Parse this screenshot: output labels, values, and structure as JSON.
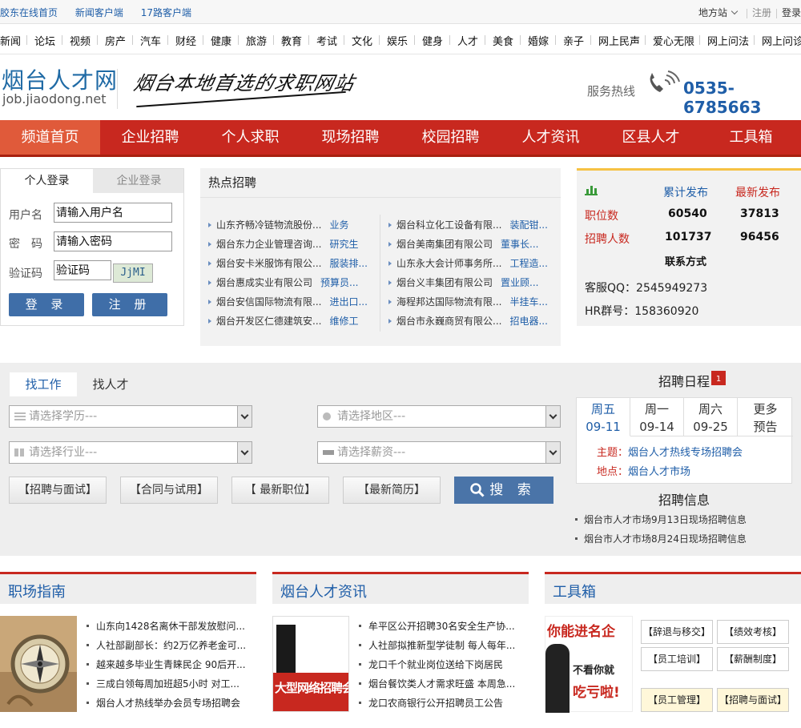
{
  "topbar": {
    "links": [
      "胶东在线首页",
      "新闻客户端",
      "17路客户端"
    ],
    "regional": "地方站",
    "register": "注册",
    "login": "登录"
  },
  "channels": [
    "新闻",
    "论坛",
    "视频",
    "房产",
    "汽车",
    "财经",
    "健康",
    "旅游",
    "教育",
    "考试",
    "文化",
    "娱乐",
    "健身",
    "人才",
    "美食",
    "婚嫁",
    "亲子",
    "网上民声",
    "爱心无限",
    "网上问法",
    "网上问诊"
  ],
  "header": {
    "logo_cn": "烟台人才网",
    "logo_en": "job.jiaodong.net",
    "slogan": "烟台本地首选的求职网站",
    "hotline_label": "服务热线",
    "hotline_number": "0535-6785663"
  },
  "mainnav": [
    "频道首页",
    "企业招聘",
    "个人求职",
    "现场招聘",
    "校园招聘",
    "人才资讯",
    "区县人才",
    "工具箱"
  ],
  "login": {
    "tab_personal": "个人登录",
    "tab_company": "企业登录",
    "username_label": "用户名",
    "username_value": "请输入用户名",
    "password_label": "密　码",
    "password_value": "请输入密码",
    "captcha_label": "验证码",
    "captcha_value": "验证码",
    "captcha_image": "JjMI",
    "login_btn": "登 录",
    "register_btn": "注 册"
  },
  "hot": {
    "title": "热点招聘",
    "left": [
      {
        "company": "山东齐畅冷链物流股份...",
        "job": "业务"
      },
      {
        "company": "烟台东力企业管理咨询...",
        "job": "研究生"
      },
      {
        "company": "烟台安卡米服饰有限公...",
        "job": "服装排..."
      },
      {
        "company": "烟台惠成实业有限公司",
        "job": "预算员..."
      },
      {
        "company": "烟台安信国际物流有限...",
        "job": "进出口..."
      },
      {
        "company": "烟台开发区仁德建筑安...",
        "job": "维修工"
      }
    ],
    "right": [
      {
        "company": "烟台科立化工设备有限...",
        "job": "装配钳..."
      },
      {
        "company": "烟台美南集团有限公司",
        "job": "董事长..."
      },
      {
        "company": "山东永大会计师事务所...",
        "job": "工程造..."
      },
      {
        "company": "烟台义丰集团有限公司",
        "job": "置业顾..."
      },
      {
        "company": "海程邦达国际物流有限...",
        "job": "半挂车..."
      },
      {
        "company": "烟台市永巍商贸有限公...",
        "job": "招电器..."
      }
    ]
  },
  "stats": {
    "col1": "累计发布",
    "col2": "最新发布",
    "row1_label": "职位数",
    "row1_total": "60540",
    "row1_new": "37813",
    "row2_label": "招聘人数",
    "row2_total": "101737",
    "row2_new": "96456",
    "contact_title": "联系方式",
    "qq": "客服QQ：2545949273",
    "hr_group": "HR群号：158360920"
  },
  "search": {
    "tab_find_job": "找工作",
    "tab_find_talent": "找人才",
    "education": "请选择学历---",
    "region": "请选择地区---",
    "industry": "请选择行业---",
    "salary": "请选择薪资---",
    "quick": [
      "【招聘与面试】",
      "【合同与试用】",
      "【 最新职位】",
      "【最新简历】"
    ],
    "search_btn": "搜 索"
  },
  "calendar": {
    "title": "招聘日程",
    "icon_num": "1",
    "days": [
      {
        "week": "周五",
        "date": "09-11"
      },
      {
        "week": "周一",
        "date": "09-14"
      },
      {
        "week": "周六",
        "date": "09-25"
      },
      {
        "week": "更多",
        "date": "预告"
      }
    ],
    "theme_label": "主题：",
    "theme_value": "烟台人才热线专场招聘会",
    "place_label": "地点：",
    "place_value": "烟台人才市场"
  },
  "info": {
    "title": "招聘信息",
    "items": [
      "烟台市人才市场9月13日现场招聘信息",
      "烟台市人才市场8月24日现场招聘信息"
    ]
  },
  "guide": {
    "title": "职场指南",
    "items": [
      "山东向1428名离休干部发放慰问...",
      "人社部副部长：约2万亿养老金可...",
      "越来越多毕业生青睐民企  90后开...",
      "三成白领每周加班超5小时  对工...",
      "烟台人才热线举办会员专场招聘会"
    ]
  },
  "news": {
    "title": "烟台人才资讯",
    "image_text": "大型网络招聘会",
    "items": [
      "牟平区公开招聘30名安全生产协...",
      "人社部拟推新型学徒制  每人每年...",
      "龙口千个就业岗位送给下岗居民",
      "烟台餐饮类人才需求旺盛  本周急...",
      "龙口农商银行公开招聘员工公告"
    ]
  },
  "tools": {
    "title": "工具箱",
    "image_line1": "你能进名企",
    "image_line2": "不看你就",
    "image_line3": "吃亏啦!",
    "buttons": [
      "【辞退与移交】",
      "【绩效考核】",
      "【员工培训】",
      "【薪酬制度】",
      "【员工管理】",
      "【招聘与面试】"
    ]
  },
  "colors": {
    "brand_red": "#c8281f",
    "link_blue": "#1f5ea8",
    "button_blue": "#3f6ea8"
  }
}
